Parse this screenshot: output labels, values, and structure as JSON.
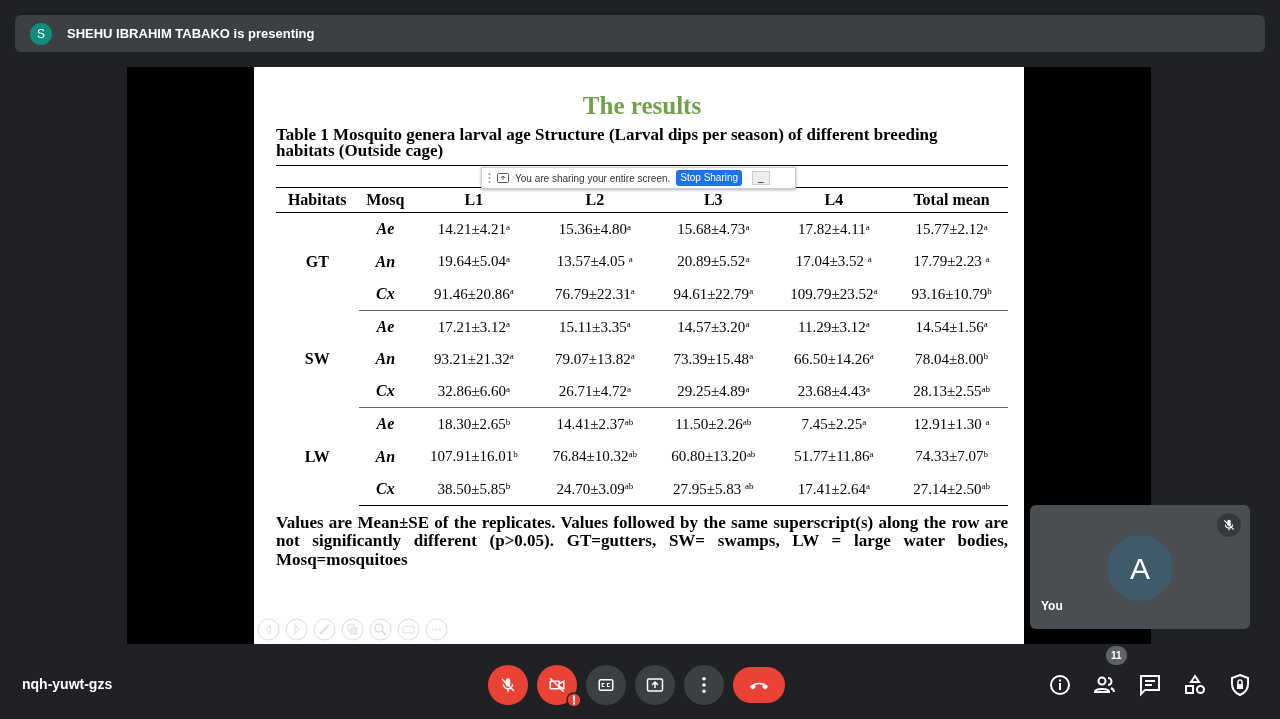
{
  "presenter_bar": {
    "avatar_letter": "S",
    "text": "SHEHU IBRAHIM TABAKO is presenting"
  },
  "slide": {
    "title": "The results",
    "caption": "Table 1 Mosquito genera larval age Structure (Larval dips per season) of different breeding habitats (Outside cage)",
    "columns": [
      "Habitats",
      "Mosq",
      "L1",
      "L2",
      "L3",
      "L4",
      "Total mean"
    ],
    "groups": [
      {
        "habitat": "GT",
        "rows": [
          {
            "mosq": "Ae",
            "values": [
              "14.21±4.21$^{a}$",
              "15.36±4.80$^{a}$",
              "15.68±4.73$^{a}$",
              "17.82±4.11$^{a}$",
              "15.77±2.12$^{a}$"
            ]
          },
          {
            "mosq": "An",
            "values": [
              "19.64±5.04$^{a}$",
              "13.57±4.05 $^{a}$",
              "20.89±5.52$^{a}$",
              "17.04±3.52 $^{a}$",
              "17.79±2.23 $^{a}$"
            ]
          },
          {
            "mosq": "Cx",
            "values": [
              "91.46±20.86$^{a}$",
              "76.79±22.31$^{a}$",
              "94.61±22.79$^{a}$",
              "109.79±23.52$^{a}$",
              "93.16±10.79$^{b}$"
            ]
          }
        ]
      },
      {
        "habitat": "SW",
        "rows": [
          {
            "mosq": "Ae",
            "values": [
              "17.21±3.12$^{a}$",
              "15.11±3.35$^{a}$",
              "14.57±3.20$^{a}$",
              "11.29±3.12$^{a}$",
              "14.54±1.56$^{a}$"
            ]
          },
          {
            "mosq": "An",
            "values": [
              "93.21±21.32$^{a}$",
              "79.07±13.82$^{a}$",
              "73.39±15.48$^{a}$",
              "66.50±14.26$^{a}$",
              "78.04±8.00$^{b}$"
            ]
          },
          {
            "mosq": "Cx",
            "values": [
              "32.86±6.60$^{a}$",
              "26.71±4.72$^{a}$",
              "29.25±4.89$^{a}$",
              "23.68±4.43$^{a}$",
              "28.13±2.55$^{ab}$"
            ]
          }
        ]
      },
      {
        "habitat": "LW",
        "rows": [
          {
            "mosq": "Ae",
            "values": [
              "18.30±2.65$^{b}$",
              "14.41±2.37$^{ab}$",
              "11.50±2.26$^{ab}$",
              "7.45±2.25$^{a}$",
              "12.91±1.30 $^{a}$"
            ]
          },
          {
            "mosq": "An",
            "values": [
              "107.91±16.01$^{b}$",
              "76.84±10.32$^{ab}$",
              "60.80±13.20$^{ab}$",
              "51.77±11.86$^{a}$",
              "74.33±7.07$^{b}$"
            ]
          },
          {
            "mosq": "Cx",
            "values": [
              "38.50±5.85$^{b}$",
              "24.70±3.09$^{ab}$",
              "27.95±5.83 $^{ab}$",
              "17.41±2.64$^{a}$",
              "27.14±2.50$^{ab}$"
            ]
          }
        ]
      }
    ],
    "footnote": "Values are Mean±SE of the replicates. Values followed by the same superscript(s) along the row are not significantly different (p>0.05). GT=gutters, SW= swamps, LW = large water bodies, Mosq=mosquitoes"
  },
  "sharing_bar": {
    "message": "You are sharing your entire screen.",
    "button": "Stop Sharing",
    "minimize": "_"
  },
  "self_tile": {
    "avatar_letter": "A",
    "label": "You",
    "muted": true
  },
  "meeting_code": "nqh-yuwt-gzs",
  "controls": {
    "mic_on": false,
    "camera_on": false
  },
  "participants_count": "11"
}
